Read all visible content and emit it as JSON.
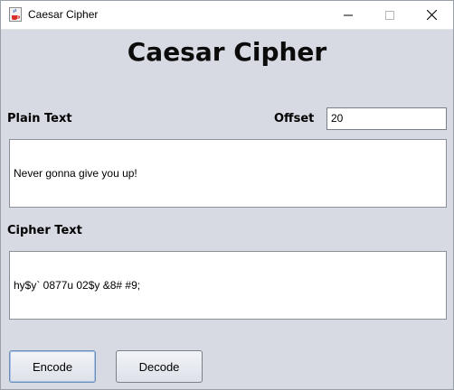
{
  "window": {
    "title": "Caesar Cipher",
    "app_icon": "java-cup-icon",
    "controls": [
      "minimize-icon",
      "maximize-icon",
      "close-icon"
    ]
  },
  "main": {
    "heading": "Caesar Cipher",
    "plain_label": "Plain Text",
    "offset_label": "Offset",
    "offset_value": "20",
    "plain_text": "Never gonna give you up!",
    "cipher_label": "Cipher Text",
    "cipher_text": "hy$y` 0877u 02$y &8# #9;"
  },
  "buttons": {
    "encode_label": "Encode",
    "decode_label": "Decode"
  },
  "colors": {
    "background": "#d7dae2",
    "focus_border": "#6a8fbd"
  }
}
